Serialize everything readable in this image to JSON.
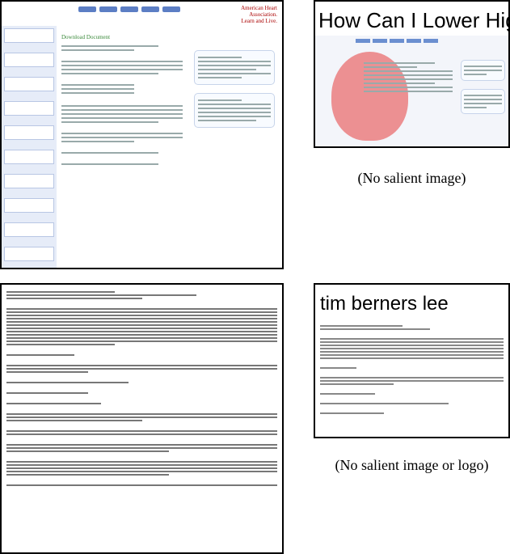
{
  "panels": [
    {
      "id": "aha-page",
      "title": "Download Document"
    },
    {
      "id": "aha-search",
      "title_text": "How Can I Lower High",
      "caption": "(No salient image)"
    },
    {
      "id": "text-doc"
    },
    {
      "id": "tbl-search",
      "title_text": "tim berners lee",
      "caption": "(No salient image or logo)"
    }
  ],
  "aha": {
    "logo_line1": "American Heart",
    "logo_line2": "Association.",
    "logo_line3": "Learn and Live."
  },
  "colors": {
    "aha_red": "#c8102e",
    "aha_blue": "#5c7ec4",
    "heading_green": "#3b8a3b"
  }
}
